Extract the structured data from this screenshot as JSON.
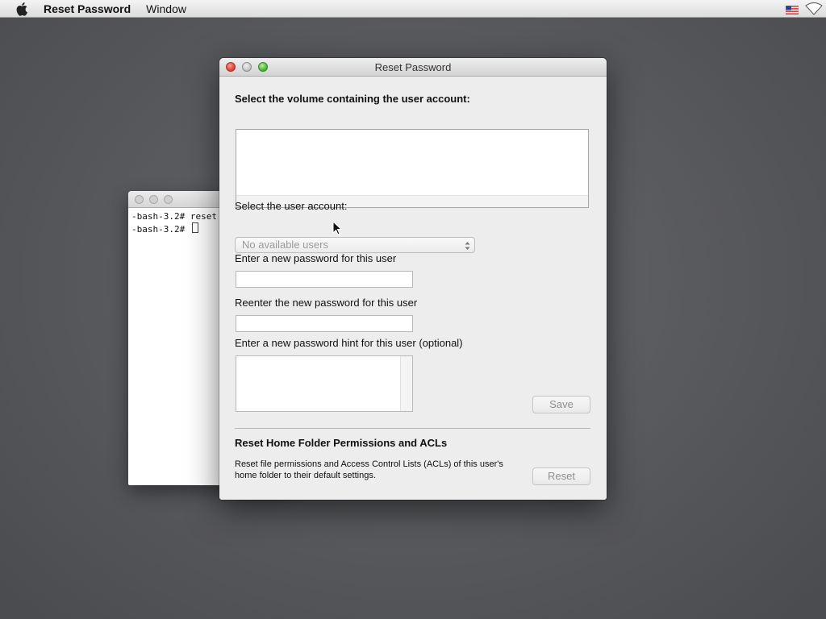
{
  "menubar": {
    "app_name": "Reset Password",
    "items": [
      "Window"
    ]
  },
  "terminal": {
    "lines": [
      "-bash-3.2# reset",
      "-bash-3.2# "
    ]
  },
  "dialog": {
    "title": "Reset Password",
    "volume_label": "Select the volume containing the user account:",
    "user_label": "Select the user account:",
    "user_popup_value": "No available users",
    "new_password_label": "Enter a new password for this user",
    "new_password_value": "",
    "reenter_label": "Reenter the new password for this user",
    "reenter_value": "",
    "hint_label": "Enter a new password hint for this user (optional)",
    "hint_value": "",
    "save_label": "Save",
    "permissions_title": "Reset Home Folder Permissions and ACLs",
    "permissions_desc": "Reset file permissions and Access Control Lists (ACLs) of this user's home folder to their default settings.",
    "reset_label": "Reset"
  },
  "colors": {
    "desktop": "#5a5b5f",
    "dialog_bg": "#ededed",
    "close": "#e0443a",
    "zoom": "#52b93a",
    "disabled_text": "#8f8f8f"
  },
  "icons": {
    "menubar_left": "apple-icon",
    "menubar_right": [
      "us-flag-icon",
      "wifi-icon"
    ],
    "cursor": "mouse-pointer-icon"
  }
}
